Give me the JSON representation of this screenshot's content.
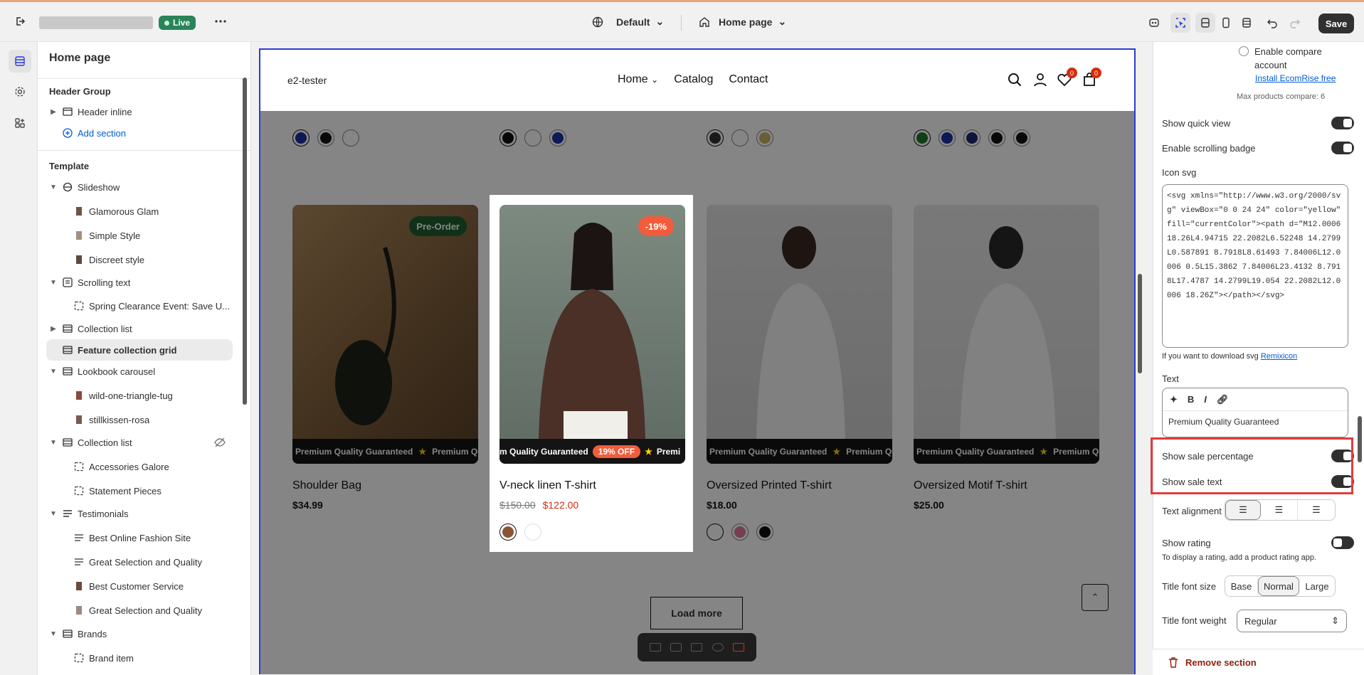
{
  "topbar": {
    "live_label": "Live",
    "theme_label": "Default",
    "page_label": "Home page",
    "save_label": "Save"
  },
  "left_panel": {
    "title": "Home page",
    "header_group_title": "Header Group",
    "header_items": [
      {
        "label": "Header inline"
      },
      {
        "label": "Add section"
      }
    ],
    "template_title": "Template",
    "template_items": [
      {
        "label": "Slideshow"
      },
      {
        "label": "Glamorous Glam"
      },
      {
        "label": "Simple Style"
      },
      {
        "label": "Discreet style"
      },
      {
        "label": "Scrolling text"
      },
      {
        "label": "Spring Clearance Event: Save U..."
      },
      {
        "label": "Collection list"
      },
      {
        "label": "Feature collection grid"
      },
      {
        "label": "Lookbook carousel"
      },
      {
        "label": "wild-one-triangle-tug"
      },
      {
        "label": "stillkissen-rosa"
      },
      {
        "label": "Collection list"
      },
      {
        "label": "Accessories Galore"
      },
      {
        "label": "Statement Pieces"
      },
      {
        "label": "Testimonials"
      },
      {
        "label": "Best Online Fashion Site"
      },
      {
        "label": "Great Selection and Quality"
      },
      {
        "label": "Best Customer Service"
      },
      {
        "label": "Great Selection and Quality"
      },
      {
        "label": "Brands"
      },
      {
        "label": "Brand item"
      }
    ]
  },
  "store": {
    "brand": "e2-tester",
    "nav": [
      "Home",
      "Catalog",
      "Contact"
    ],
    "wishlist_count": "0",
    "cart_count": "0",
    "ticker_text": "Premium Quality Guaranteed",
    "ticker_text_short": "Premium Qu",
    "products": [
      {
        "title": "Shoulder Bag",
        "price": "$34.99",
        "tag": "Pre-Order"
      },
      {
        "title": "V-neck linen T-shirt",
        "compare_price": "$150.00",
        "price": "$122.00",
        "tag": "-19%",
        "ticker_badge": "19% OFF",
        "ticker_lead": "m Quality Guaranteed",
        "ticker_tail": "Premi"
      },
      {
        "title": "Oversized Printed T-shirt",
        "price": "$18.00"
      },
      {
        "title": "Oversized Motif T-shirt",
        "price": "$25.00"
      }
    ],
    "load_more": "Load more"
  },
  "right_panel": {
    "compare_label": "Enable compare account",
    "install_link": "Install EcomRise free",
    "max_compare": "Max products compare: 6",
    "show_quick_view": "Show quick view",
    "enable_scrolling_badge": "Enable scrolling badge",
    "icon_svg_label": "Icon svg",
    "icon_svg_value": "<svg xmlns=\"http://www.w3.org/2000/svg\" viewBox=\"0 0 24 24\" color=\"yellow\" fill=\"currentColor\"><path d=\"M12.0006 18.26L4.94715 22.2082L6.52248 14.2799L0.587891 8.7918L8.61493 7.84006L12.0006 0.5L15.3862 7.84006L23.4132 8.7918L17.4787 14.2799L19.054 22.2082L12.0006 18.26Z\"></path></svg>",
    "download_hint": "If you want to download svg",
    "remixicon_link": "Remixicon",
    "text_label": "Text",
    "text_value": "Premium Quality Guaranteed",
    "show_sale_percentage": "Show sale percentage",
    "show_sale_text": "Show sale text",
    "text_alignment": "Text alignment",
    "show_rating": "Show rating",
    "rating_hint": "To display a rating, add a product rating app.",
    "title_font_size": "Title font size",
    "font_sizes": [
      "Base",
      "Normal",
      "Large"
    ],
    "title_font_weight": "Title font weight",
    "font_weight_value": "Regular",
    "remove_section": "Remove section"
  },
  "colors": {
    "accent_blue": "#2b3bd6",
    "sale_red": "#d72c0d",
    "badge_orange": "#f25c3b",
    "preorder_green": "#1f5e2f",
    "highlight_red": "#e23b3b"
  }
}
